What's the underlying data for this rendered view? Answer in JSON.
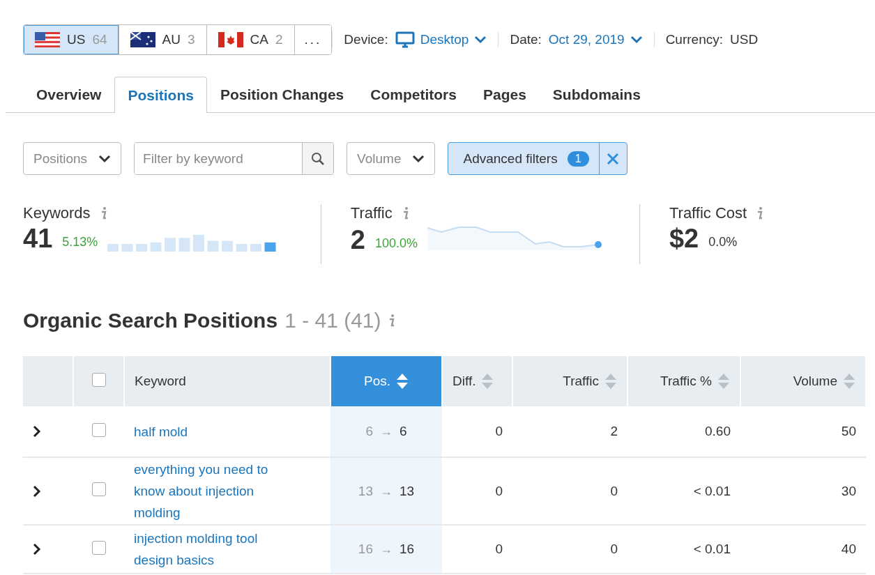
{
  "databases": [
    {
      "kind": "us",
      "code": "US",
      "count": "64",
      "selected": true
    },
    {
      "kind": "au",
      "code": "AU",
      "count": "3",
      "selected": false
    },
    {
      "kind": "ca",
      "code": "CA",
      "count": "2",
      "selected": false
    }
  ],
  "more_button": "...",
  "device": {
    "label": "Device:",
    "value": "Desktop"
  },
  "date": {
    "label": "Date:",
    "value": "Oct 29, 2019"
  },
  "currency": {
    "label": "Currency:",
    "value": "USD"
  },
  "tabs": [
    {
      "label": "Overview",
      "selected": false
    },
    {
      "label": "Positions",
      "selected": true
    },
    {
      "label": "Position Changes",
      "selected": false
    },
    {
      "label": "Competitors",
      "selected": false
    },
    {
      "label": "Pages",
      "selected": false
    },
    {
      "label": "Subdomains",
      "selected": false
    }
  ],
  "filters": {
    "positions": "Positions",
    "keyword_search": {
      "placeholder": "Filter by keyword"
    },
    "volume": "Volume",
    "advanced": {
      "label": "Advanced filters",
      "count": "1",
      "active": true
    }
  },
  "metrics": [
    {
      "kind": "bars",
      "label": "Keywords",
      "value": "41",
      "change": "5.13%",
      "color": "#3ca43c"
    },
    {
      "kind": "line",
      "label": "Traffic",
      "value": "2",
      "change": "100.0%",
      "color": "#3ca43c"
    },
    {
      "kind": "none",
      "label": "Traffic Cost",
      "value": "$2",
      "change": "0.0%",
      "color": "#333333"
    }
  ],
  "section": {
    "title": "Organic Search Positions",
    "range": "1 - 41 (41)"
  },
  "table": {
    "header_checkbox": {
      "checked": false
    },
    "columns": [
      {
        "label": "Keyword",
        "sortable": false,
        "selected": false
      },
      {
        "label": "Pos.",
        "sortable": true,
        "selected": true
      },
      {
        "label": "Diff.",
        "sortable": true,
        "selected": false
      },
      {
        "label": "Traffic",
        "sortable": true,
        "selected": false
      },
      {
        "label": "Traffic %",
        "sortable": true,
        "selected": false
      },
      {
        "label": "Volume",
        "sortable": true,
        "selected": false
      }
    ],
    "rows": [
      {
        "keyword": "half mold",
        "pos_from": "6",
        "pos_arrow": "→",
        "pos_to": "6",
        "diff": "0",
        "traffic": "2",
        "traffic_pct": "0.60",
        "volume": "50",
        "checked": false
      },
      {
        "keyword": "everything you need to know about injection molding",
        "pos_from": "13",
        "pos_arrow": "→",
        "pos_to": "13",
        "diff": "0",
        "traffic": "0",
        "traffic_pct": "< 0.01",
        "volume": "30",
        "checked": false
      },
      {
        "keyword": "injection molding tool design basics",
        "pos_from": "16",
        "pos_arrow": "→",
        "pos_to": "16",
        "diff": "0",
        "traffic": "0",
        "traffic_pct": "< 0.01",
        "volume": "40",
        "checked": false
      }
    ]
  }
}
